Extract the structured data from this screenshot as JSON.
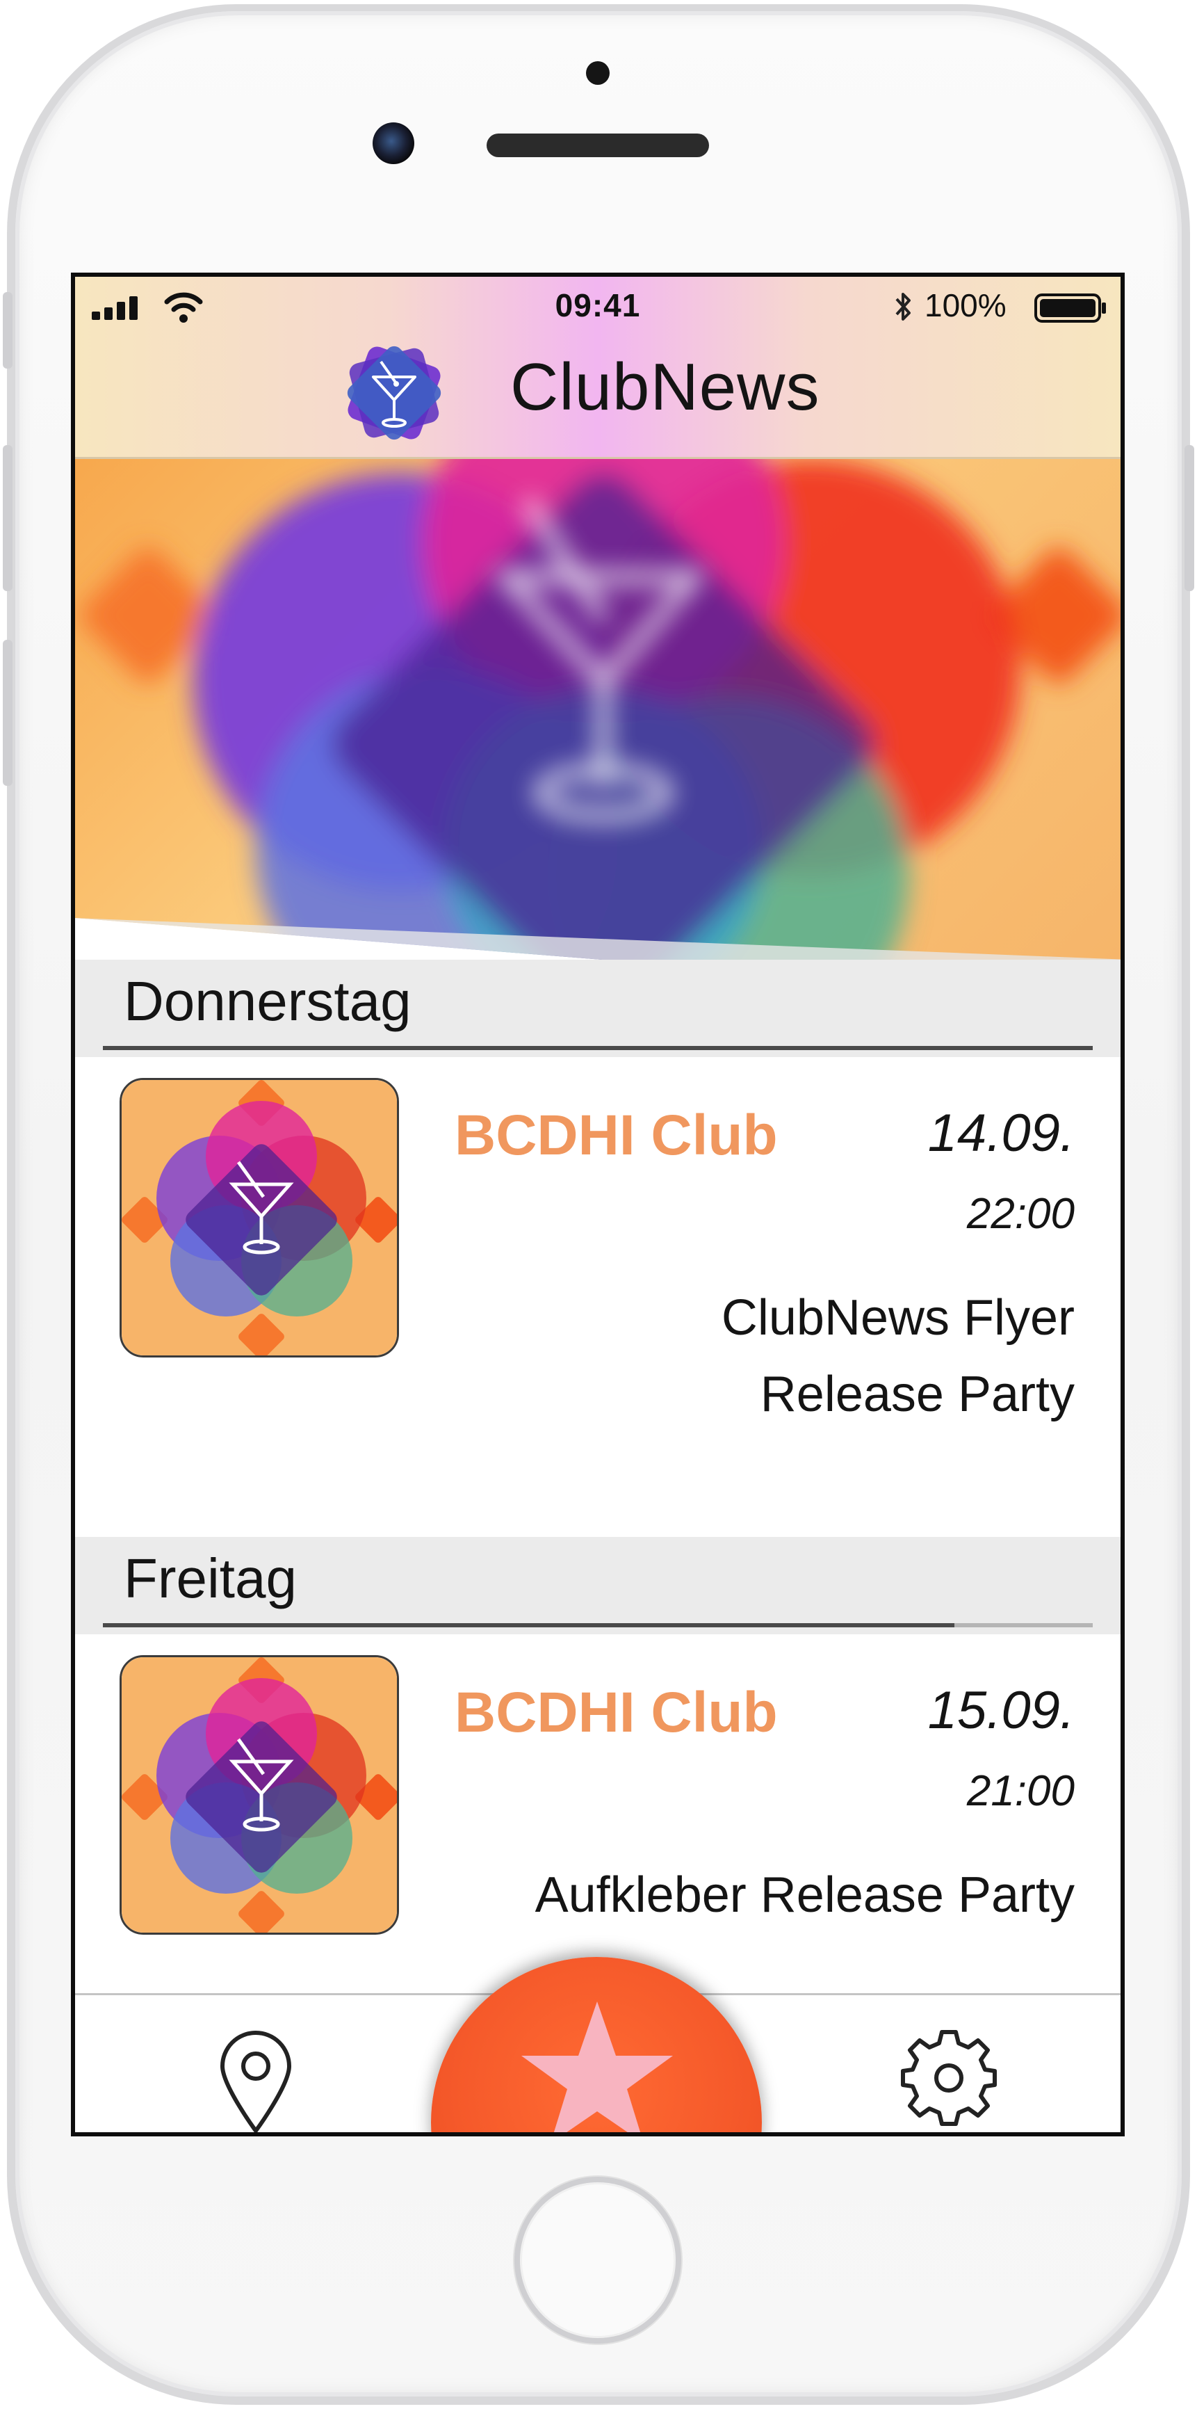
{
  "status_bar": {
    "time": "09:41",
    "battery": "100%"
  },
  "app": {
    "title": "ClubNews",
    "accent_color": "#f0975e",
    "fab_color": "#f5592a"
  },
  "sections": [
    {
      "day": "Donnerstag",
      "progress": 1.0,
      "events": [
        {
          "club": "BCDHI Club",
          "date": "14.09.",
          "time": "22:00",
          "title_line1": "ClubNews Flyer",
          "title_line2": "Release Party"
        }
      ]
    },
    {
      "day": "Freitag",
      "progress": 0.86,
      "events": [
        {
          "club": "BCDHI Club",
          "date": "15.09.",
          "time": "21:00",
          "title_line1": "Aufkleber Release Party"
        }
      ]
    }
  ],
  "tabbar": {
    "items": [
      "location-pin-icon",
      "star-icon",
      "gear-icon"
    ]
  }
}
